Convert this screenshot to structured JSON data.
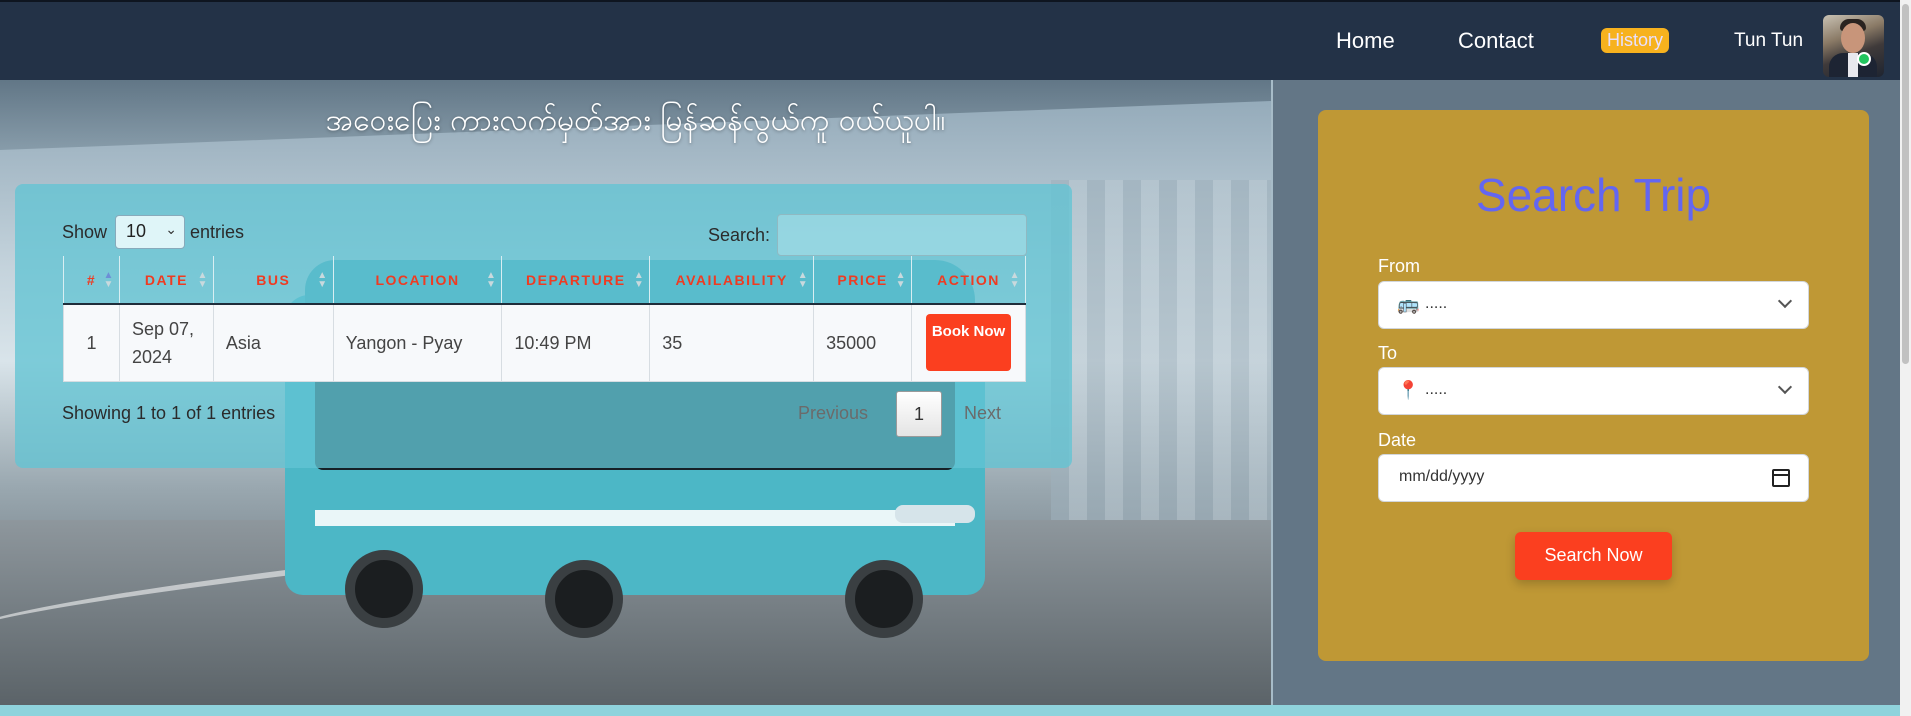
{
  "nav": {
    "home": "Home",
    "contact": "Contact",
    "history": "History",
    "user_name": "Tun Tun"
  },
  "hero": {
    "title": "အဝေးပြေး ကားလက်မှတ်အား မြန်ဆန်လွယ်ကူ ဝယ်ယူပါ။"
  },
  "table": {
    "show_label": "Show",
    "page_size": "10",
    "entries_label": "entries",
    "search_label": "Search:",
    "search_value": "",
    "columns": [
      "#",
      "DATE",
      "BUS",
      "LOCATION",
      "DEPARTURE",
      "AVAILABILITY",
      "PRICE",
      "ACTION"
    ],
    "rows": [
      {
        "no": "1",
        "date": "Sep 07, 2024",
        "bus": "Asia",
        "location": "Yangon - Pyay",
        "departure": "10:49 PM",
        "availability": "35",
        "price": "35000",
        "action": "Book Now"
      }
    ],
    "info": "Showing 1 to 1 of 1 entries",
    "prev": "Previous",
    "page": "1",
    "next": "Next"
  },
  "search_trip": {
    "title": "Search Trip",
    "from_label": "From",
    "from_value": ".....",
    "from_icon": "bus-icon",
    "to_label": "To",
    "to_value": ".....",
    "to_icon": "pin-icon",
    "date_label": "Date",
    "date_placeholder": "mm/dd/yyyy",
    "button": "Search Now"
  },
  "colors": {
    "navbar": "#233247",
    "accent": "#fb3f1f",
    "history_badge": "#f7b21e",
    "search_card": "#bf9835",
    "search_title": "#6366f1"
  }
}
